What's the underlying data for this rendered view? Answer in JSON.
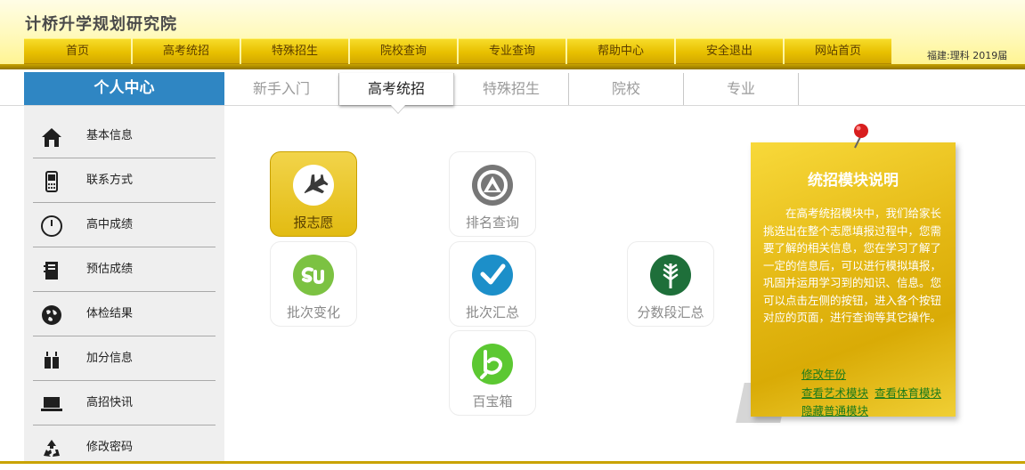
{
  "site": {
    "title": "计桥升学规划研究院"
  },
  "topnav": {
    "items": [
      "首页",
      "高考统招",
      "特殊招生",
      "院校查询",
      "专业查询",
      "帮助中心",
      "安全退出",
      "网站首页"
    ]
  },
  "user_meta": "福建:理科 2019届",
  "personal_center": {
    "title": "个人中心"
  },
  "subtabs": {
    "items": [
      "新手入门",
      "高考统招",
      "特殊招生",
      "院校",
      "专业"
    ],
    "active_index": 1
  },
  "sidebar": {
    "items": [
      {
        "label": "基本信息",
        "icon": "home-icon"
      },
      {
        "label": "联系方式",
        "icon": "phone-icon"
      },
      {
        "label": "高中成绩",
        "icon": "clock-icon"
      },
      {
        "label": "预估成绩",
        "icon": "notebook-icon"
      },
      {
        "label": "体检结果",
        "icon": "globe-icon"
      },
      {
        "label": "加分信息",
        "icon": "gift-icon"
      },
      {
        "label": "高招快讯",
        "icon": "laptop-icon"
      },
      {
        "label": "修改密码",
        "icon": "recycle-icon"
      }
    ]
  },
  "tiles": [
    {
      "label": "报志愿",
      "icon": "airplane-icon",
      "color": "#3a3a3a",
      "active": true
    },
    {
      "label": "排名查询",
      "icon": "ranking-icon",
      "color": "#777777"
    },
    {
      "label": "批次变化",
      "icon": "stumble-icon",
      "color": "#7cc242"
    },
    {
      "label": "批次汇总",
      "icon": "check-icon",
      "color": "#1c8fc9"
    },
    {
      "label": "分数段汇总",
      "icon": "leaf-icon",
      "color": "#1e6f3a"
    },
    {
      "label": "百宝箱",
      "icon": "bebo-icon",
      "color": "#5cc832"
    }
  ],
  "note": {
    "title": "统招模块说明",
    "body": "在高考统招模块中，我们给家长挑选出在整个志愿填报过程中，您需要了解的相关信息，您在学习了解了一定的信息后，可以进行模拟填报，巩固并运用学习到的知识、信息。您可以点击左侧的按钮，进入各个按钮对应的页面，进行查询等其它操作。",
    "links": {
      "change_year": "修改年份",
      "art": "查看艺术模块",
      "sports": "查看体育模块",
      "hide_normal": "隐藏普通模块"
    }
  },
  "colors": {
    "accent_gold": "#e4b814",
    "pc_blue": "#2f86c3",
    "link_green": "#1b7a1b"
  }
}
